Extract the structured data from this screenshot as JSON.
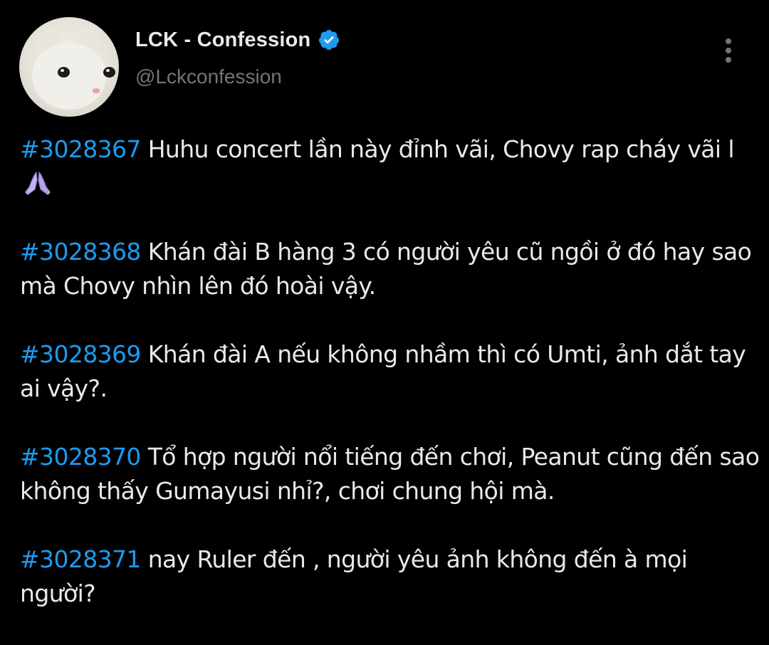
{
  "header": {
    "display_name": "LCK - Confession",
    "handle": "@Lckconfession",
    "verified_icon": "verified-badge-icon",
    "more_icon": "more-vertical-icon",
    "avatar_icon": "white-cat-avatar"
  },
  "colors": {
    "background": "#000000",
    "text": "#e7e9ea",
    "secondary": "#71767b",
    "hashtag": "#1d9bf0",
    "verified": "#1d9bf0"
  },
  "posts": [
    {
      "tag": "#3028367",
      "text": " Huhu concert lần này đỉnh vãi, Chovy rap cháy vãi l",
      "emoji": "folded-hands-emoji"
    },
    {
      "tag": "#3028368",
      "text": " Khán đài B hàng 3 có người yêu cũ ngồi ở đó hay sao mà Chovy nhìn lên đó hoài vậy."
    },
    {
      "tag": "#3028369",
      "text": " Khán đài A nếu không nhầm thì có Umti, ảnh dắt tay ai vậy?."
    },
    {
      "tag": "#3028370",
      "text": " Tổ hợp người nổi tiếng đến chơi, Peanut cũng đến sao không thấy Gumayusi nhỉ?, chơi chung hội mà."
    },
    {
      "tag": "#3028371",
      "text": " nay Ruler đến , người yêu ảnh không đến à mọi người?"
    }
  ]
}
